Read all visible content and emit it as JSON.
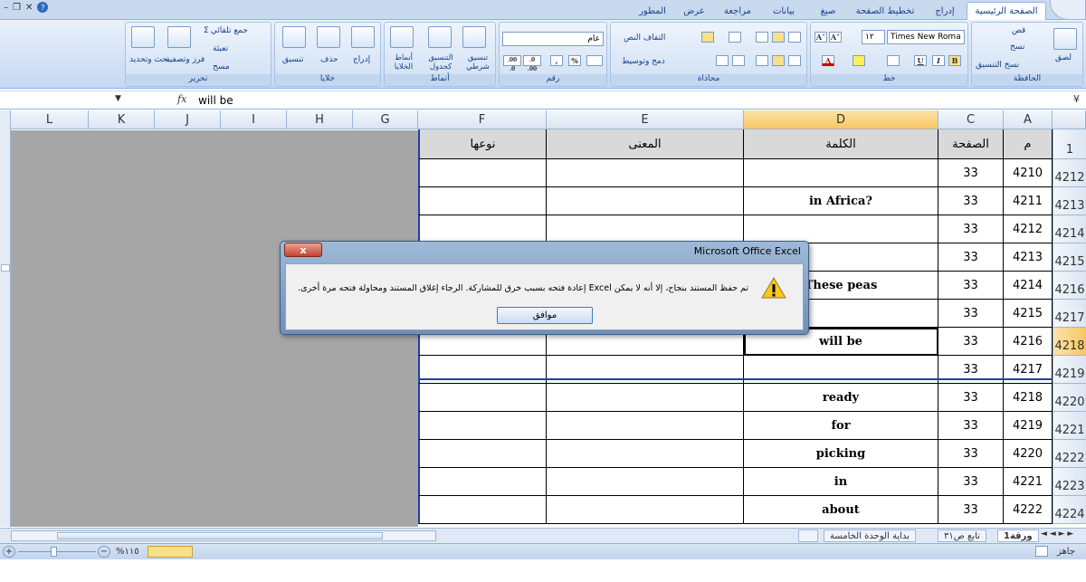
{
  "window": {
    "minimize": "–",
    "restore": "❐",
    "close": "✕",
    "help": "?"
  },
  "tabs": [
    "الصفحة الرئيسية",
    "إدراج",
    "تخطيط الصفحة",
    "صيغ",
    "بيانات",
    "مراجعة",
    "عرض",
    "المطور"
  ],
  "ribbon": {
    "clipboard": {
      "title": "الحافظة",
      "paste": "لصق",
      "cut": "قص",
      "copy": "نسخ",
      "format_painter": "نسخ التنسيق"
    },
    "font": {
      "title": "خط",
      "font_name": "Times New Roma",
      "font_size": "١٢",
      "bold": "B",
      "italic": "I",
      "underline": "U",
      "grow": "A˄",
      "shrink": "A˅"
    },
    "alignment": {
      "title": "محاذاة",
      "wrap": "التفاف النص",
      "merge": "دمج وتوسيط"
    },
    "number": {
      "title": "رقم",
      "format": "عام",
      "percent": "%",
      "comma": ",",
      "inc_dec": ".0 .00",
      "dec_dec": ".00 .0"
    },
    "styles": {
      "title": "أنماط",
      "conditional": "تنسيق شرطي",
      "table": "التنسيق كجدول",
      "cell_styles": "أنماط الخلايا"
    },
    "cells": {
      "title": "خلايا",
      "insert": "إدراج",
      "delete": "حذف",
      "format": "تنسيق"
    },
    "editing": {
      "title": "تحرير",
      "autosum": "جمع تلقائي",
      "fill": "تعبئة",
      "clear": "مسح",
      "sort": "فرز وتصفية",
      "find": "بحث وتحديد"
    }
  },
  "formula_bar": {
    "fx": "fx",
    "content": "will be"
  },
  "columns": [
    "A",
    "C",
    "D",
    "E",
    "F",
    "G",
    "H",
    "I",
    "J",
    "K",
    "L"
  ],
  "header_row": {
    "row_num": "1",
    "A": "م",
    "C": "الصفحة",
    "D": "الكلمة",
    "E": "المعنى",
    "F": "نوعها"
  },
  "rows": [
    {
      "num": "4212",
      "A": "4210",
      "C": "33",
      "D": ""
    },
    {
      "num": "4213",
      "A": "4211",
      "C": "33",
      "D": "in Africa?"
    },
    {
      "num": "4214",
      "A": "4212",
      "C": "33",
      "D": ""
    },
    {
      "num": "4215",
      "A": "4213",
      "C": "33",
      "D": ""
    },
    {
      "num": "4216",
      "A": "4214",
      "C": "33",
      "D": "These peas"
    },
    {
      "num": "4217",
      "A": "4215",
      "C": "33",
      "D": ""
    },
    {
      "num": "4218",
      "A": "4216",
      "C": "33",
      "D": "will be"
    },
    {
      "num": "4219",
      "A": "4217",
      "C": "33",
      "D": ""
    },
    {
      "num": "4220",
      "A": "4218",
      "C": "33",
      "D": "ready"
    },
    {
      "num": "4221",
      "A": "4219",
      "C": "33",
      "D": "for"
    },
    {
      "num": "4222",
      "A": "4220",
      "C": "33",
      "D": "picking"
    },
    {
      "num": "4223",
      "A": "4221",
      "C": "33",
      "D": "in"
    },
    {
      "num": "4224",
      "A": "4222",
      "C": "33",
      "D": "about"
    }
  ],
  "sheet_tabs": [
    "ورقة1",
    "تابع ص٣١",
    "بداية الوحدة الخامسة"
  ],
  "status": {
    "ready": "جاهز",
    "zoom": "%١١٥",
    "zoom_minus": "−",
    "zoom_plus": "+"
  },
  "dialog": {
    "title": "Microsoft Office Excel",
    "close": "x",
    "message": "تم حفظ المستند بنجاح، إلا أنه لا يمكن Excel إعادة فتحه بسبب خرق للمشاركة. الرجاء إغلاق المستند ومحاولة فتحه مرة أخرى.",
    "ok": "موافق"
  }
}
